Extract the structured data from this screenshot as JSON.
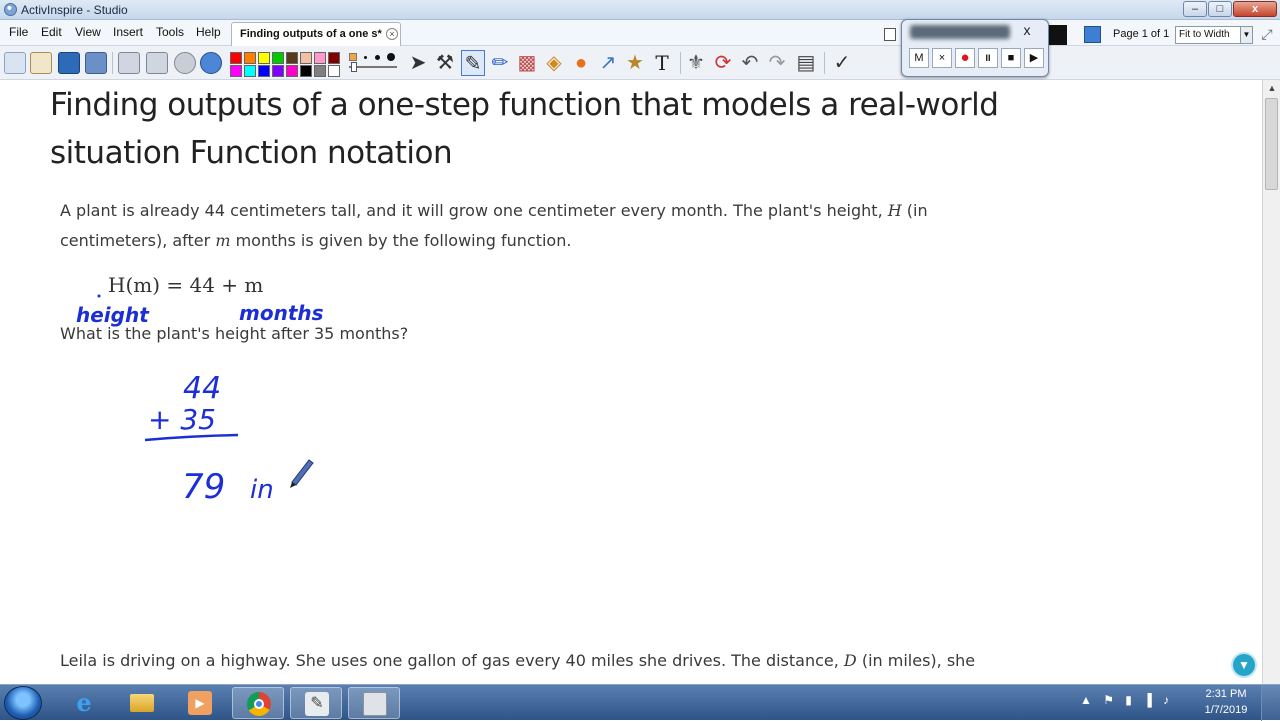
{
  "window": {
    "title": "ActivInspire - Studio",
    "minimize": "–",
    "maximize": "□",
    "close": "x"
  },
  "menu": {
    "items": [
      "File",
      "Edit",
      "View",
      "Insert",
      "Tools",
      "Help"
    ],
    "document_tab": "Finding outputs of a one s*",
    "document_tab_close": "×"
  },
  "toolbar": {
    "colors": [
      "#ff0000",
      "#ff8000",
      "#ffff00",
      "#00cc00",
      "#5a3a1a",
      "#f0c0a0",
      "#ff99cc",
      "#800000",
      "#ff00ff",
      "#00ffff",
      "#0000ff",
      "#8000ff",
      "#ff00cc",
      "#000000",
      "#808080",
      "#ffffff"
    ],
    "text_tool_glyph": "T",
    "active_tool": "pen"
  },
  "page_controls": {
    "page_label": "Page 1 of 1",
    "fit_value": "Fit to Width"
  },
  "recorder": {
    "close": "x",
    "buttons": [
      "M",
      "×",
      "●",
      "II",
      "■",
      "▶"
    ]
  },
  "page": {
    "title_line1": "Finding outputs of a one-step function that models a real-world",
    "title_line2": "situation Function notation",
    "problem1": {
      "line1_a": "A plant is already 44 centimeters tall, and it will grow one centimeter every month. The plant's height, ",
      "line1_var": "H",
      "line1_b": " (in",
      "line2_a": "centimeters), after ",
      "line2_var": "m",
      "line2_b": " months is given by the following function.",
      "formula": "H(m) = 44 + m",
      "question": "What is the plant's height after 35 months?"
    },
    "problem2": {
      "line1_a": "Leila is driving on a highway. She uses one gallon of gas every 40 miles she drives. The distance, ",
      "line1_var": "D",
      "line1_b": " (in miles), she"
    },
    "handwriting": {
      "label_left": "height",
      "label_right": "months",
      "addend1": "44",
      "addend2": "+ 35",
      "result": "79",
      "unit": "in",
      "ink_color": "#1c2fd6"
    }
  },
  "taskbar": {
    "apps": [
      "internet-explorer",
      "file-explorer",
      "media-player",
      "chrome",
      "activinspire",
      "calculator"
    ],
    "tray": "▲ ⚑ ▮ ▐ ♪",
    "time": "2:31 PM",
    "date": "1/7/2019"
  }
}
